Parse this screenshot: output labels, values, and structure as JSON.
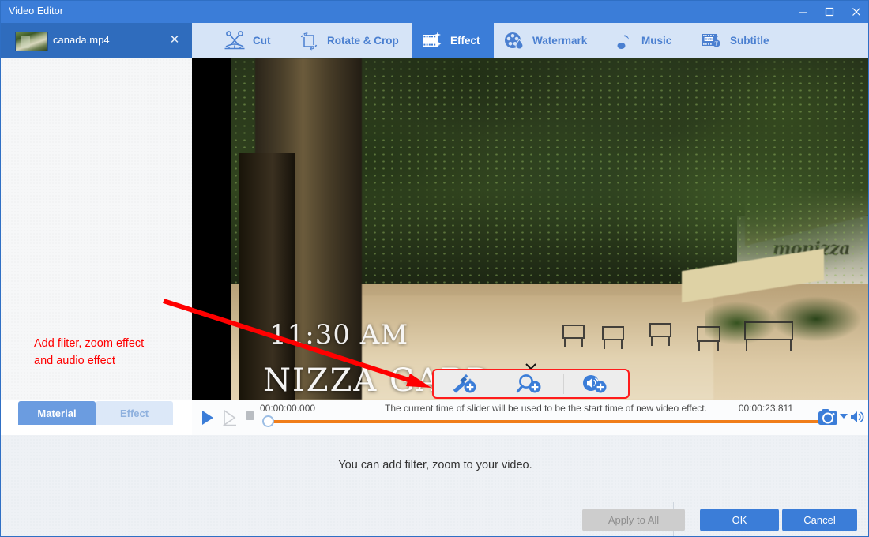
{
  "window": {
    "title": "Video Editor",
    "minimize_label": "minimize",
    "maximize_label": "maximize",
    "close_label": "close"
  },
  "file_tab": {
    "name": "canada.mp4",
    "close_label": "✕"
  },
  "toolbar": {
    "items": [
      {
        "label": "Cut",
        "icon": "scissors-icon",
        "active": false
      },
      {
        "label": "Rotate & Crop",
        "icon": "rotate-crop-icon",
        "active": false
      },
      {
        "label": "Effect",
        "icon": "film-sparkle-icon",
        "active": true
      },
      {
        "label": "Watermark",
        "icon": "droplet-film-icon",
        "active": false
      },
      {
        "label": "Music",
        "icon": "music-note-icon",
        "active": false
      },
      {
        "label": "Subtitle",
        "icon": "subtitle-icon",
        "active": false
      }
    ]
  },
  "annotation": {
    "line1": "Add fliter, zoom effect",
    "line2": "and audio effect",
    "color": "#ff0000"
  },
  "left_panel": {
    "tabs": [
      {
        "label": "Material",
        "selected": true
      },
      {
        "label": "Effect",
        "selected": false
      }
    ]
  },
  "preview": {
    "overlay_time": "11:30 AM",
    "overlay_place": "NIZZA GARD",
    "sign_text": "monizza"
  },
  "effect_popup": {
    "highlight_color": "#ff1c1c",
    "buttons": [
      {
        "label": "Add filter",
        "icon": "magic-wand-plus-icon"
      },
      {
        "label": "Add zoom",
        "icon": "magnifier-plus-icon"
      },
      {
        "label": "Add audio effect",
        "icon": "speaker-plus-icon"
      }
    ]
  },
  "player": {
    "play_label": "play",
    "pause_label": "pause",
    "stop_label": "stop",
    "current_time": "00:00:00.000",
    "total_time": "00:00:23.811",
    "hint": "The current time of slider will be used to be the start time of new video effect.",
    "progress_percent": 0,
    "track_color": "#f07e1a",
    "snapshot_label": "snapshot",
    "volume_label": "volume"
  },
  "bottom": {
    "message": "You can add filter, zoom to your video.",
    "buttons": [
      {
        "label": "Apply to All",
        "style": "disabled"
      },
      {
        "label": "OK",
        "style": "primary"
      },
      {
        "label": "Cancel",
        "style": "primary"
      }
    ]
  }
}
